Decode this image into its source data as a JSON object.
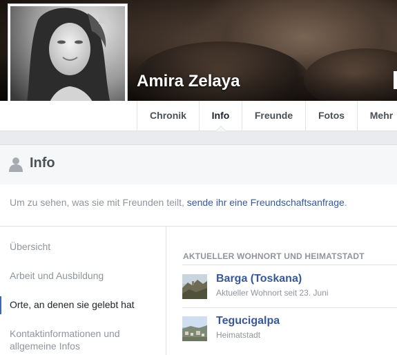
{
  "profile": {
    "name": "Amira Zelaya"
  },
  "nav": {
    "items": [
      {
        "label": "Chronik"
      },
      {
        "label": "Info"
      },
      {
        "label": "Freunde"
      },
      {
        "label": "Fotos"
      },
      {
        "label": "Mehr"
      }
    ],
    "active": "Info"
  },
  "section": {
    "title": "Info",
    "icon": "person-icon"
  },
  "notice": {
    "text": "Um zu sehen, was sie mit Freunden teilt, ",
    "link": "sende ihr eine Freundschaftsanfrage",
    "suffix": "."
  },
  "sidebar": {
    "items": [
      {
        "label": "Übersicht"
      },
      {
        "label": "Arbeit und Ausbildung"
      },
      {
        "label": "Orte, an denen sie gelebt hat"
      },
      {
        "label": "Kontaktinformationen und allgemeine Infos"
      }
    ],
    "active": "Orte, an denen sie gelebt hat"
  },
  "places": {
    "heading": "AKTUELLER WOHNORT UND HEIMATSTADT",
    "items": [
      {
        "name": "Barga (Toskana)",
        "detail": "Aktueller Wohnort seit 23. Juni"
      },
      {
        "name": "Tegucigalpa",
        "detail": "Heimatstadt"
      }
    ]
  },
  "colors": {
    "link": "#365899",
    "accent": "#4267b2",
    "muted": "#90949c"
  }
}
